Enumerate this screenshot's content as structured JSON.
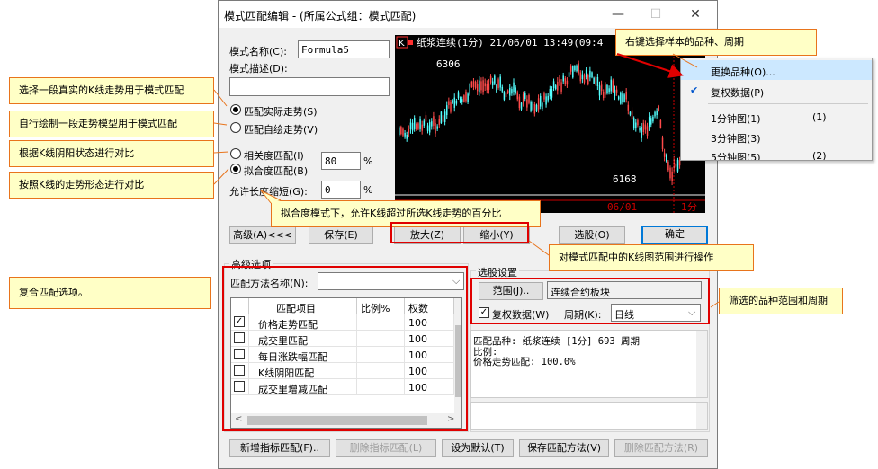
{
  "window": {
    "title": "模式匹配编辑 - (所属公式组：模式匹配)",
    "minimize": "—",
    "maximize": "☐",
    "close": "✕"
  },
  "form": {
    "name_label": "模式名称(C):",
    "name_value": "Formula5",
    "desc_label": "模式描述(D):",
    "desc_value": "",
    "radio_actual": "匹配实际走势(S)",
    "radio_draw": "匹配自绘走势(V)",
    "radio_corr": "相关度匹配(I)",
    "radio_fit": "拟合度匹配(B)",
    "corr_value": "80",
    "fit_value": "0",
    "percent": "%",
    "length_label": "允许长度缩短(G):"
  },
  "chart": {
    "header": "纸浆连续(1分) 21/06/01 13:49(09:4",
    "header_badge": "K",
    "high_label": "6306",
    "low_label": "6168",
    "date_label": "06/01",
    "period_label": "1分",
    "colors": {
      "up": "#ff4a4a",
      "down": "#54ffff"
    }
  },
  "buttons": {
    "advanced": "高级(A)<<<",
    "save": "保存(E)",
    "zoom_in": "放大(Z)",
    "zoom_out": "缩小(Y)",
    "select": "选股(O)",
    "ok": "确定",
    "add_indicator": "新增指标匹配(F)..",
    "delete_indicator": "删除指标匹配(L)",
    "set_default": "设为默认(T)",
    "save_method": "保存匹配方法(V)",
    "delete_method": "删除匹配方法(R)"
  },
  "advanced": {
    "group_label": "高级选项",
    "method_label": "匹配方法名称(N):",
    "method_value": "",
    "columns": [
      "匹配项目",
      "比例%",
      "权数"
    ],
    "rows": [
      {
        "checked": true,
        "name": "价格走势匹配",
        "ratio": "",
        "weight": "100"
      },
      {
        "checked": false,
        "name": "成交里匹配",
        "ratio": "",
        "weight": "100"
      },
      {
        "checked": false,
        "name": "每日涨跌幅匹配",
        "ratio": "",
        "weight": "100"
      },
      {
        "checked": false,
        "name": "K线阴阳匹配",
        "ratio": "",
        "weight": "100"
      },
      {
        "checked": false,
        "name": "成交里增减匹配",
        "ratio": "",
        "weight": "100"
      }
    ]
  },
  "selection": {
    "group_label": "选股设置",
    "range_button": "范围(J)..",
    "range_value": "连续合约板块",
    "adjusted_label": "复权数据(W)",
    "period_label": "周期(K):",
    "period_value": "日线",
    "info_line1": "匹配品种: 纸浆连续 [1分] 693 周期",
    "info_line2": "比例:",
    "info_line3": "价格走势匹配: 100.0%"
  },
  "menu": {
    "items": [
      {
        "label": "更换品种(O)...",
        "shortcut": ""
      },
      {
        "label": "复权数据(P)",
        "shortcut": ""
      },
      {
        "label": "1分钟图(1)",
        "shortcut": "(1)"
      },
      {
        "label": "3分钟图(3)",
        "shortcut": ""
      },
      {
        "label": "5分钟图(5)",
        "shortcut": "(2)"
      }
    ],
    "check_mark": "✔"
  },
  "annotations": {
    "select_real": "选择一段真实的K线走势用于模式匹配",
    "draw_model": "自行绘制一段走势模型用于模式匹配",
    "corr": "根据K线阴阳状态进行对比",
    "fit": "按照K线的走势形态进行对比",
    "fit_percent": "拟合度模式下，允许K线超过所选K线走势的百分比",
    "right_click": "右键选择样本的品种、周期",
    "zoom": "对模式匹配中的K线图范围进行操作",
    "filter": "筛选的品种范围和周期",
    "composite": "复合匹配选项。"
  }
}
